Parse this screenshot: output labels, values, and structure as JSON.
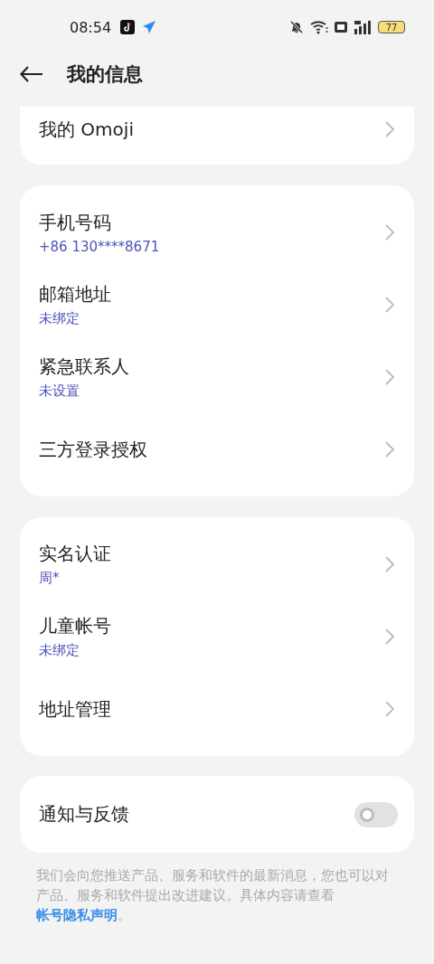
{
  "status_bar": {
    "time": "08:54",
    "battery": "77"
  },
  "header": {
    "title": "我的信息"
  },
  "groups": [
    {
      "rows": [
        {
          "title": "我的 Omoji"
        }
      ]
    },
    {
      "rows": [
        {
          "title": "手机号码",
          "subtitle": "+86 130****8671"
        },
        {
          "title": "邮箱地址",
          "subtitle": "未绑定"
        },
        {
          "title": "紧急联系人",
          "subtitle": "未设置"
        },
        {
          "title": "三方登录授权"
        }
      ]
    },
    {
      "rows": [
        {
          "title": "实名认证",
          "subtitle": "周*"
        },
        {
          "title": "儿童帐号",
          "subtitle": "未绑定"
        },
        {
          "title": "地址管理"
        }
      ]
    }
  ],
  "notification": {
    "label": "通知与反馈",
    "on": false
  },
  "footer": {
    "text": "我们会向您推送产品、服务和软件的最新消息，您也可以对产品、服务和软件提出改进建议。具体内容请查看 ",
    "link": "帐号隐私声明",
    "after": "。"
  }
}
